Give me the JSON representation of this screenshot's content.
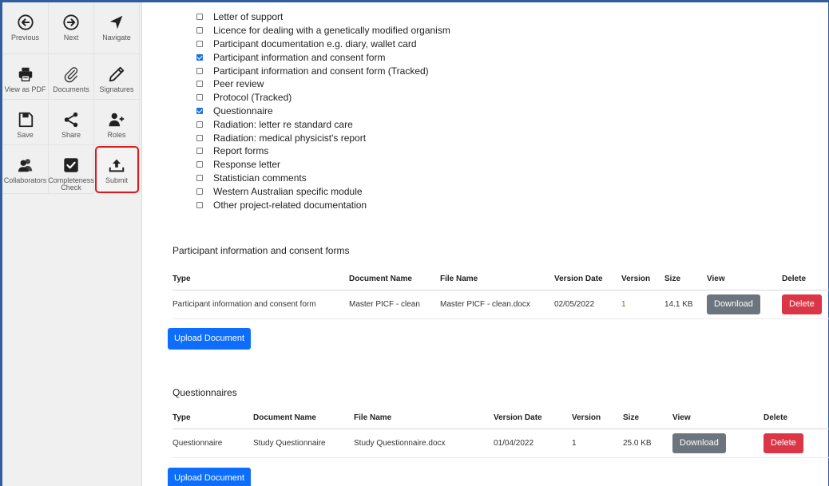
{
  "toolbar": {
    "buttons": [
      {
        "label": "Previous",
        "icon": "previous-circle-icon"
      },
      {
        "label": "Next",
        "icon": "next-circle-icon"
      },
      {
        "label": "Navigate",
        "icon": "navigate-arrow-icon"
      },
      {
        "label": "View as PDF",
        "icon": "printer-icon"
      },
      {
        "label": "Documents",
        "icon": "paperclip-icon"
      },
      {
        "label": "Signatures",
        "icon": "pen-icon"
      },
      {
        "label": "Save",
        "icon": "save-disk-icon"
      },
      {
        "label": "Share",
        "icon": "share-icon"
      },
      {
        "label": "Roles",
        "icon": "user-plus-icon"
      },
      {
        "label": "Collaborators",
        "icon": "users-icon"
      },
      {
        "label": "Completeness Check",
        "icon": "checkbox-checked-icon"
      },
      {
        "label": "Submit",
        "icon": "upload-tray-icon"
      }
    ],
    "highlighted": "Submit",
    "highlight_color": "#d81b1b"
  },
  "documents_checklist": [
    {
      "label": "Letter of support",
      "checked": false
    },
    {
      "label": "Licence for dealing with a genetically modified organism",
      "checked": false
    },
    {
      "label": "Participant documentation e.g. diary, wallet card",
      "checked": false
    },
    {
      "label": "Participant information and consent form",
      "checked": true
    },
    {
      "label": "Participant information and consent form (Tracked)",
      "checked": false
    },
    {
      "label": "Peer review",
      "checked": false
    },
    {
      "label": "Protocol (Tracked)",
      "checked": false
    },
    {
      "label": "Questionnaire",
      "checked": true
    },
    {
      "label": "Radiation: letter re standard care",
      "checked": false
    },
    {
      "label": "Radiation: medical physicist's report",
      "checked": false
    },
    {
      "label": "Report forms",
      "checked": false
    },
    {
      "label": "Response letter",
      "checked": false
    },
    {
      "label": "Statistician comments",
      "checked": false
    },
    {
      "label": "Western Australian specific module",
      "checked": false
    },
    {
      "label": "Other project-related documentation",
      "checked": false
    }
  ],
  "picf": {
    "title": "Participant information and consent forms",
    "headers": {
      "type": "Type",
      "document_name": "Document Name",
      "file_name": "File Name",
      "version_date": "Version Date",
      "version": "Version",
      "size": "Size",
      "view": "View",
      "delete": "Delete"
    },
    "row": {
      "type": "Participant information and consent form",
      "document_name": "Master PICF - clean",
      "file_name": "Master PICF - clean.docx",
      "version_date": "02/05/2022",
      "version": "1",
      "size": "14.1 KB",
      "download_label": "Download",
      "delete_label": "Delete"
    },
    "upload_label": "Upload Document"
  },
  "questionnaires": {
    "title": "Questionnaires",
    "headers": {
      "type": "Type",
      "document_name": "Document Name",
      "file_name": "File Name",
      "version_date": "Version Date",
      "version": "Version",
      "size": "Size",
      "view": "View",
      "delete": "Delete"
    },
    "row": {
      "type": "Questionnaire",
      "document_name": "Study Questionnaire",
      "file_name": "Study Questionnaire.docx",
      "version_date": "01/04/2022",
      "version": "1",
      "size": "25.0 KB",
      "download_label": "Download",
      "delete_label": "Delete"
    },
    "upload_label": "Upload Document"
  },
  "colors": {
    "primary": "#0d6efd",
    "secondary": "#6c757d",
    "danger": "#dc3545",
    "checkbox": "#1a73e8"
  }
}
